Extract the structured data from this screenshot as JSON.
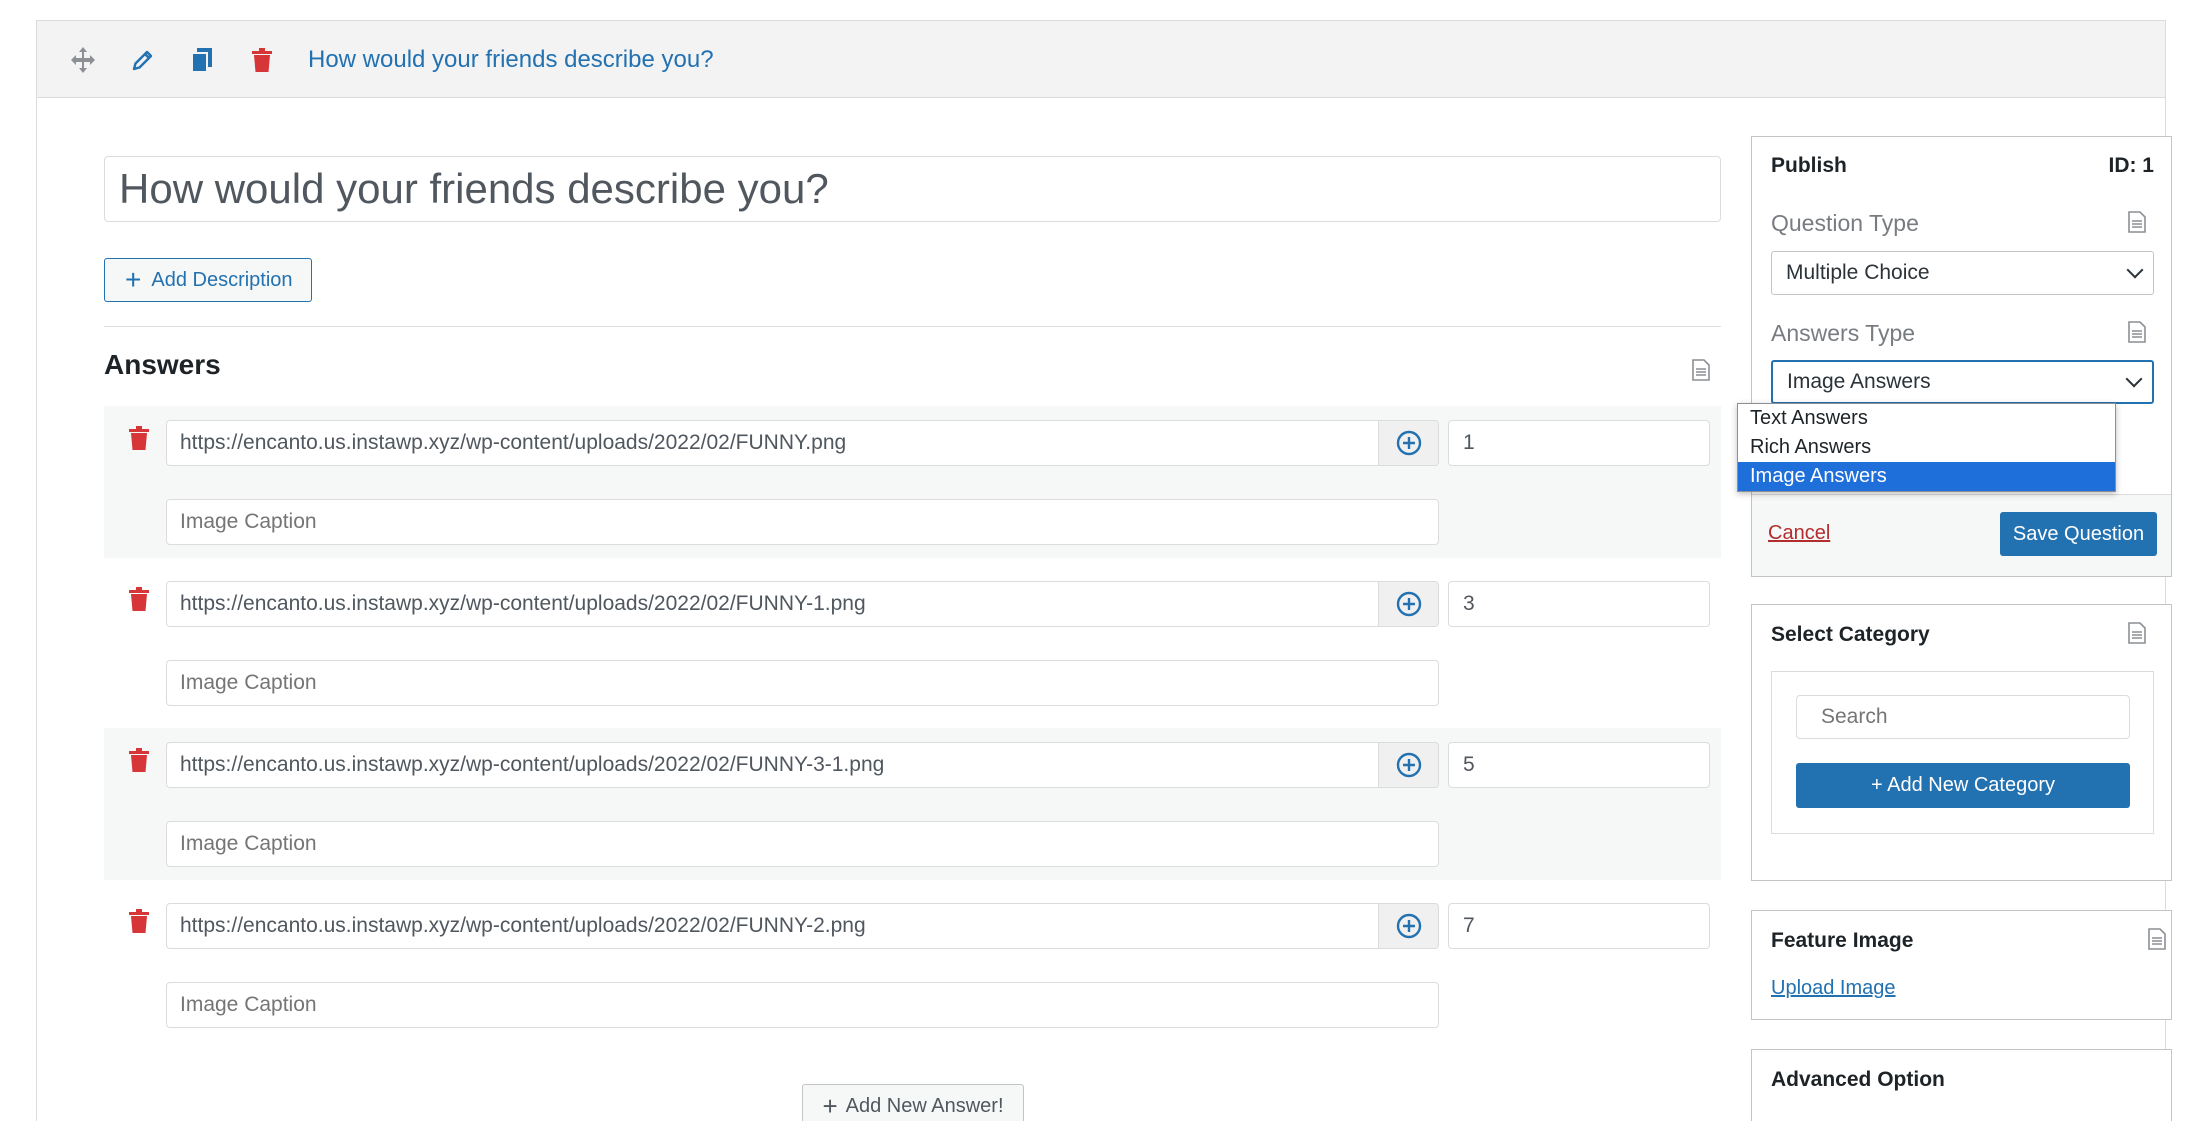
{
  "toolbar": {
    "title": "How would your friends describe you?",
    "icons": [
      "move-icon",
      "pencil-icon",
      "copy-icon",
      "trash-icon"
    ]
  },
  "question": {
    "title": "How would your friends describe you?",
    "add_description_label": "Add Description"
  },
  "answers": {
    "heading": "Answers",
    "items": [
      {
        "url": "https://encanto.us.instawp.xyz/wp-content/uploads/2022/02/FUNNY.png",
        "points": "1",
        "caption_placeholder": "Image Caption"
      },
      {
        "url": "https://encanto.us.instawp.xyz/wp-content/uploads/2022/02/FUNNY-1.png",
        "points": "3",
        "caption_placeholder": "Image Caption"
      },
      {
        "url": "https://encanto.us.instawp.xyz/wp-content/uploads/2022/02/FUNNY-3-1.png",
        "points": "5",
        "caption_placeholder": "Image Caption"
      },
      {
        "url": "https://encanto.us.instawp.xyz/wp-content/uploads/2022/02/FUNNY-2.png",
        "points": "7",
        "caption_placeholder": "Image Caption"
      }
    ],
    "add_new_label": "Add New Answer!"
  },
  "publish": {
    "title": "Publish",
    "id_label": "ID: 1",
    "question_type_label": "Question Type",
    "question_type_value": "Multiple Choice",
    "answers_type_label": "Answers Type",
    "answers_type_value": "Image Answers",
    "answers_type_options": [
      "Text Answers",
      "Rich Answers",
      "Image Answers"
    ],
    "cancel_label": "Cancel",
    "save_label": "Save Question"
  },
  "category": {
    "title": "Select Category",
    "search_placeholder": "Search",
    "add_label": "+ Add New Category"
  },
  "feature_image": {
    "title": "Feature Image",
    "upload_label": "Upload Image"
  },
  "advanced": {
    "title": "Advanced Option"
  },
  "colors": {
    "accent": "#2271b1",
    "danger": "#d63638",
    "selected_option": "#1e6fd9"
  }
}
